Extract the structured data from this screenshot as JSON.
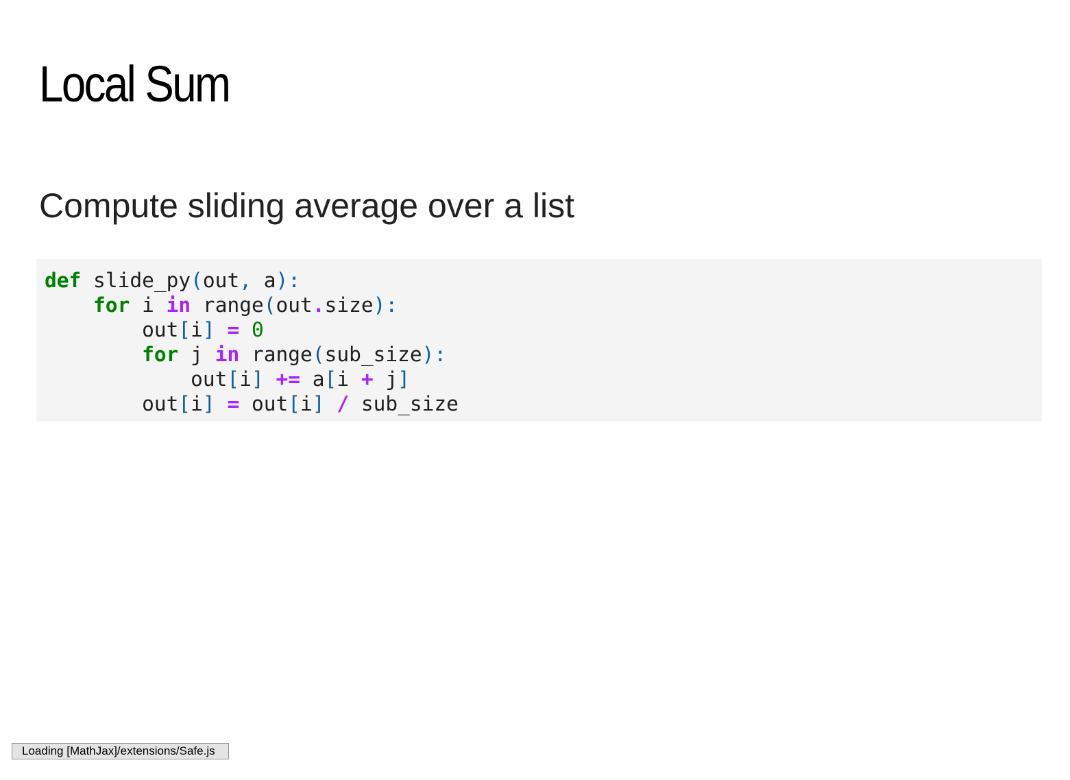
{
  "slide": {
    "title": "Local Sum",
    "subtitle": "Compute sliding average over a list"
  },
  "code": {
    "language": "python",
    "lines": [
      [
        {
          "t": "kw",
          "v": "def"
        },
        {
          "t": "n",
          "v": " slide_py"
        },
        {
          "t": "p",
          "v": "("
        },
        {
          "t": "n",
          "v": "out"
        },
        {
          "t": "p",
          "v": ","
        },
        {
          "t": "n",
          "v": " a"
        },
        {
          "t": "p",
          "v": "):"
        }
      ],
      [
        {
          "t": "n",
          "v": "    "
        },
        {
          "t": "kw",
          "v": "for"
        },
        {
          "t": "n",
          "v": " i "
        },
        {
          "t": "op",
          "v": "in"
        },
        {
          "t": "n",
          "v": " range"
        },
        {
          "t": "p",
          "v": "("
        },
        {
          "t": "n",
          "v": "out"
        },
        {
          "t": "op",
          "v": "."
        },
        {
          "t": "n",
          "v": "size"
        },
        {
          "t": "p",
          "v": "):"
        }
      ],
      [
        {
          "t": "n",
          "v": "        out"
        },
        {
          "t": "p",
          "v": "["
        },
        {
          "t": "n",
          "v": "i"
        },
        {
          "t": "p",
          "v": "]"
        },
        {
          "t": "n",
          "v": " "
        },
        {
          "t": "op",
          "v": "="
        },
        {
          "t": "n",
          "v": " "
        },
        {
          "t": "num",
          "v": "0"
        }
      ],
      [
        {
          "t": "n",
          "v": "        "
        },
        {
          "t": "kw",
          "v": "for"
        },
        {
          "t": "n",
          "v": " j "
        },
        {
          "t": "op",
          "v": "in"
        },
        {
          "t": "n",
          "v": " range"
        },
        {
          "t": "p",
          "v": "("
        },
        {
          "t": "n",
          "v": "sub_size"
        },
        {
          "t": "p",
          "v": "):"
        }
      ],
      [
        {
          "t": "n",
          "v": "            out"
        },
        {
          "t": "p",
          "v": "["
        },
        {
          "t": "n",
          "v": "i"
        },
        {
          "t": "p",
          "v": "]"
        },
        {
          "t": "n",
          "v": " "
        },
        {
          "t": "op",
          "v": "+="
        },
        {
          "t": "n",
          "v": " a"
        },
        {
          "t": "p",
          "v": "["
        },
        {
          "t": "n",
          "v": "i "
        },
        {
          "t": "op",
          "v": "+"
        },
        {
          "t": "n",
          "v": " j"
        },
        {
          "t": "p",
          "v": "]"
        }
      ],
      [
        {
          "t": "n",
          "v": "        out"
        },
        {
          "t": "p",
          "v": "["
        },
        {
          "t": "n",
          "v": "i"
        },
        {
          "t": "p",
          "v": "]"
        },
        {
          "t": "n",
          "v": " "
        },
        {
          "t": "op",
          "v": "="
        },
        {
          "t": "n",
          "v": " out"
        },
        {
          "t": "p",
          "v": "["
        },
        {
          "t": "n",
          "v": "i"
        },
        {
          "t": "p",
          "v": "]"
        },
        {
          "t": "n",
          "v": " "
        },
        {
          "t": "op",
          "v": "/"
        },
        {
          "t": "n",
          "v": " sub_size"
        }
      ]
    ]
  },
  "status": {
    "mathjax_message": "Loading [MathJax]/extensions/Safe.js"
  },
  "colors": {
    "keyword": "#008000",
    "operator": "#aa22ff",
    "punctuation": "#0b5ea8",
    "number": "#008000",
    "code_background": "#f4f4f4"
  }
}
